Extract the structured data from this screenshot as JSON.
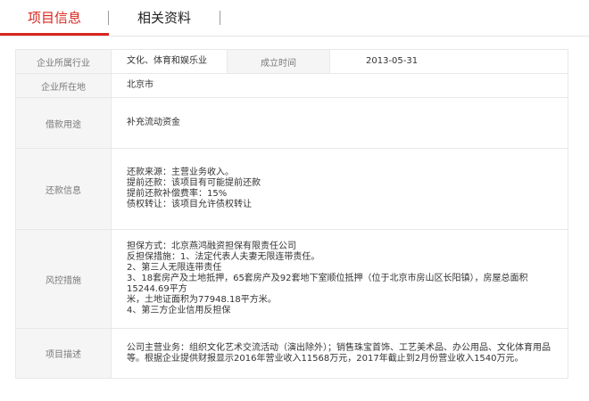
{
  "tabs": {
    "items": [
      {
        "label": "项目信息",
        "active": true
      },
      {
        "label": "相关资料",
        "active": false
      }
    ],
    "accent_color": "#d9251d"
  },
  "info": {
    "industry_label": "企业所属行业",
    "industry_value": "文化、体育和娱乐业",
    "established_label": "成立时间",
    "established_value": "2013-05-31",
    "location_label": "企业所在地",
    "location_value": "北京市",
    "purpose_label": "借款用途",
    "purpose_value": "补充流动资金",
    "repayment_label": "还款信息",
    "repayment_lines": [
      "还款来源：主营业务收入。",
      "提前还款：该项目有可能提前还款",
      "提前还款补偿费率：15%",
      "债权转让：该项目允许债权转让"
    ],
    "risk_label": "风控措施",
    "risk_lines": [
      "担保方式：北京燕鸿融资担保有限责任公司",
      "反担保措施：1、法定代表人夫妻无限连带责任。",
      "2、第三人无限连带责任",
      "3、18套房产及土地抵押，65套房产及92套地下室顺位抵押（位于北京市房山区长阳镇），房屋总面积15244.69平方",
      "米，土地证面积为77948.18平方米。",
      "4、第三方企业信用反担保"
    ],
    "description_label": "项目描述",
    "description_value": "公司主营业务：组织文化艺术交流活动（演出除外）；销售珠宝首饰、工艺美术品、办公用品、文化体育用品等。根据企业提供财报显示2016年营业收入11568万元，2017年截止到2月份营业收入1540万元。"
  }
}
